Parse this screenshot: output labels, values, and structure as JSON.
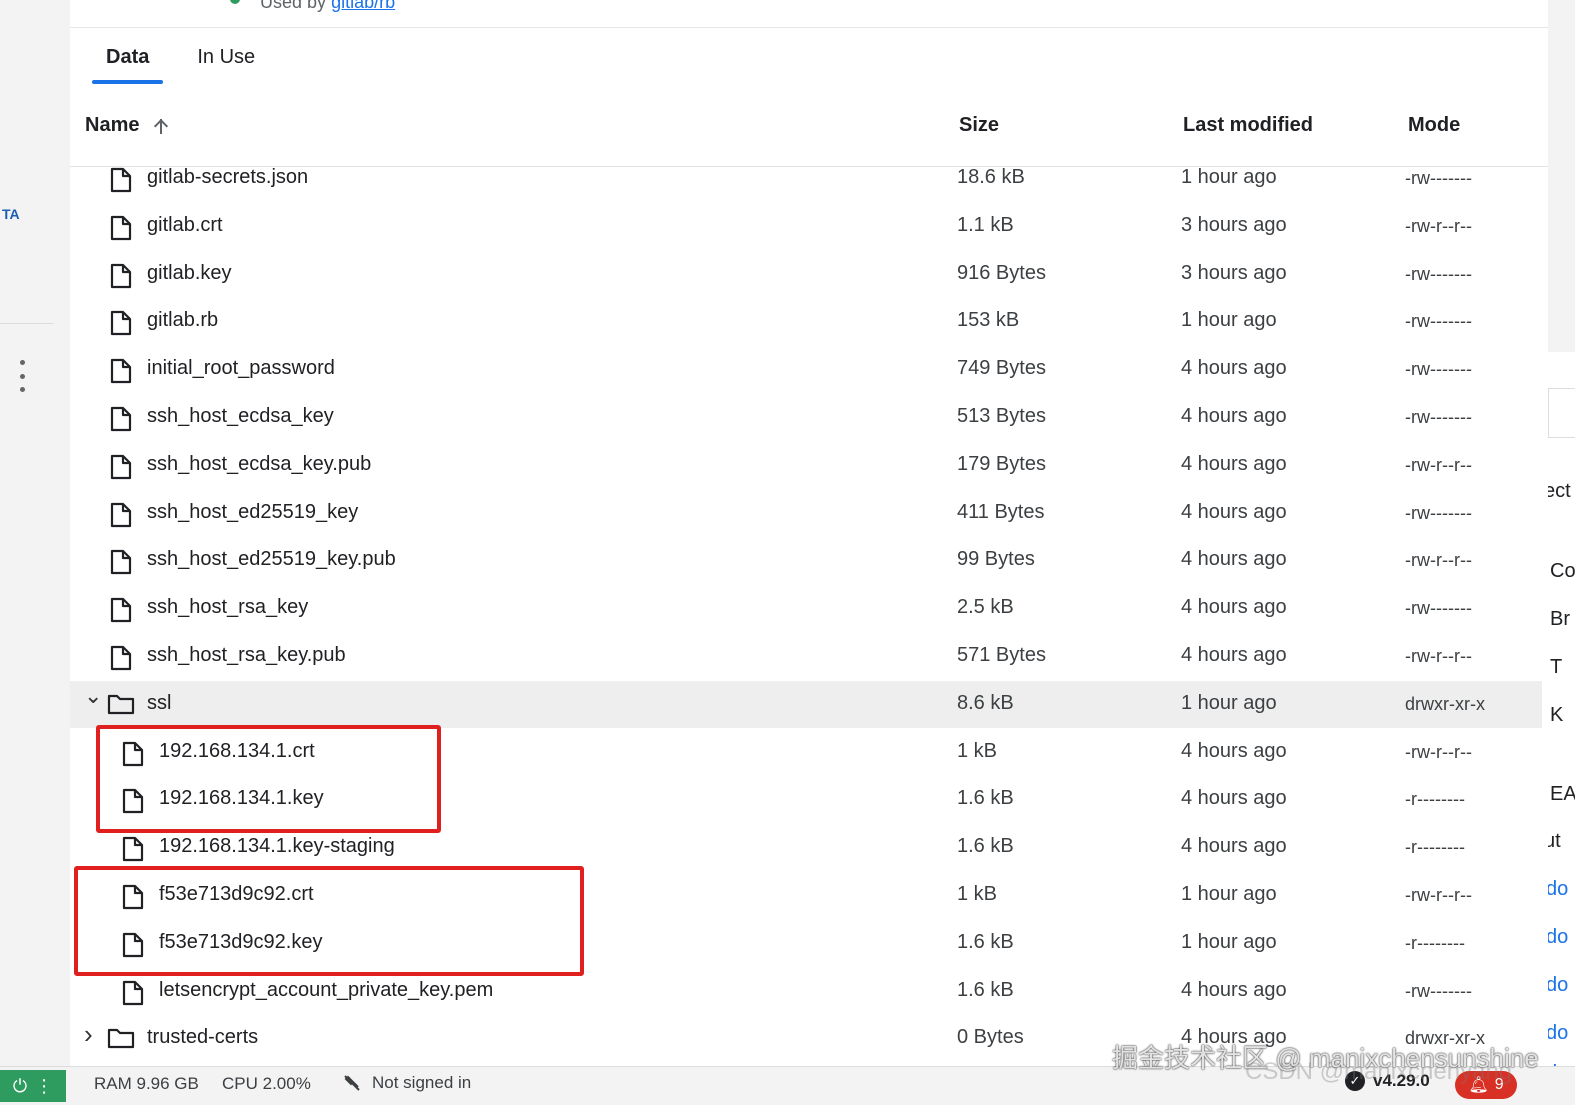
{
  "top": {
    "used_by_prefix": "Used by",
    "used_by_link": "gitlab/rb"
  },
  "tabs": [
    {
      "label": "Data",
      "active": true
    },
    {
      "label": "In Use",
      "active": false
    }
  ],
  "columns": {
    "name": "Name",
    "size": "Size",
    "last_modified": "Last modified",
    "mode": "Mode"
  },
  "rows": [
    {
      "type": "file",
      "name": "gitlab-secrets.json",
      "size": "18.6 kB",
      "modified": "1 hour ago",
      "mode": "-rw-------"
    },
    {
      "type": "file",
      "name": "gitlab.crt",
      "size": "1.1 kB",
      "modified": "3 hours ago",
      "mode": "-rw-r--r--"
    },
    {
      "type": "file",
      "name": "gitlab.key",
      "size": "916 Bytes",
      "modified": "3 hours ago",
      "mode": "-rw-------"
    },
    {
      "type": "file",
      "name": "gitlab.rb",
      "size": "153 kB",
      "modified": "1 hour ago",
      "mode": "-rw-------"
    },
    {
      "type": "file",
      "name": "initial_root_password",
      "size": "749 Bytes",
      "modified": "4 hours ago",
      "mode": "-rw-------"
    },
    {
      "type": "file",
      "name": "ssh_host_ecdsa_key",
      "size": "513 Bytes",
      "modified": "4 hours ago",
      "mode": "-rw-------"
    },
    {
      "type": "file",
      "name": "ssh_host_ecdsa_key.pub",
      "size": "179 Bytes",
      "modified": "4 hours ago",
      "mode": "-rw-r--r--"
    },
    {
      "type": "file",
      "name": "ssh_host_ed25519_key",
      "size": "411 Bytes",
      "modified": "4 hours ago",
      "mode": "-rw-------"
    },
    {
      "type": "file",
      "name": "ssh_host_ed25519_key.pub",
      "size": "99 Bytes",
      "modified": "4 hours ago",
      "mode": "-rw-r--r--"
    },
    {
      "type": "file",
      "name": "ssh_host_rsa_key",
      "size": "2.5 kB",
      "modified": "4 hours ago",
      "mode": "-rw-------"
    },
    {
      "type": "file",
      "name": "ssh_host_rsa_key.pub",
      "size": "571 Bytes",
      "modified": "4 hours ago",
      "mode": "-rw-r--r--"
    },
    {
      "type": "folder",
      "expanded": true,
      "name": "ssl",
      "size": "8.6 kB",
      "modified": "1 hour ago",
      "mode": "drwxr-xr-x"
    },
    {
      "type": "file",
      "nested": true,
      "name": "192.168.134.1.crt",
      "size": "1 kB",
      "modified": "4 hours ago",
      "mode": "-rw-r--r--"
    },
    {
      "type": "file",
      "nested": true,
      "name": "192.168.134.1.key",
      "size": "1.6 kB",
      "modified": "4 hours ago",
      "mode": "-r--------"
    },
    {
      "type": "file",
      "nested": true,
      "name": "192.168.134.1.key-staging",
      "size": "1.6 kB",
      "modified": "4 hours ago",
      "mode": "-r--------"
    },
    {
      "type": "file",
      "nested": true,
      "name": "f53e713d9c92.crt",
      "size": "1 kB",
      "modified": "1 hour ago",
      "mode": "-rw-r--r--"
    },
    {
      "type": "file",
      "nested": true,
      "name": "f53e713d9c92.key",
      "size": "1.6 kB",
      "modified": "1 hour ago",
      "mode": "-r--------"
    },
    {
      "type": "file",
      "nested": true,
      "name": "letsencrypt_account_private_key.pem",
      "size": "1.6 kB",
      "modified": "4 hours ago",
      "mode": "-rw-------"
    },
    {
      "type": "folder",
      "expanded": false,
      "name": "trusted-certs",
      "size": "0 Bytes",
      "modified": "4 hours ago",
      "mode": "drwxr-xr-x"
    }
  ],
  "left_rail": {
    "fragment": "TA"
  },
  "right_strip": [
    "ect",
    "Co",
    "Br",
    "T",
    "K",
    "EA",
    "ut",
    "do",
    "do",
    "do",
    "do",
    "do"
  ],
  "status_bar": {
    "ram": "RAM 9.96 GB",
    "cpu": "CPU 2.00%",
    "signin": "Not signed in",
    "version": "v4.29.0",
    "notifications": "9"
  },
  "watermark": {
    "line1": "掘金技术社区 @ manixchensunshine",
    "line2": "CSDN @manixchenyang"
  },
  "colors": {
    "accent": "#1a73e8",
    "highlight": "#e0201e",
    "engine_on": "#2e9b5f",
    "notification": "#d93025"
  }
}
